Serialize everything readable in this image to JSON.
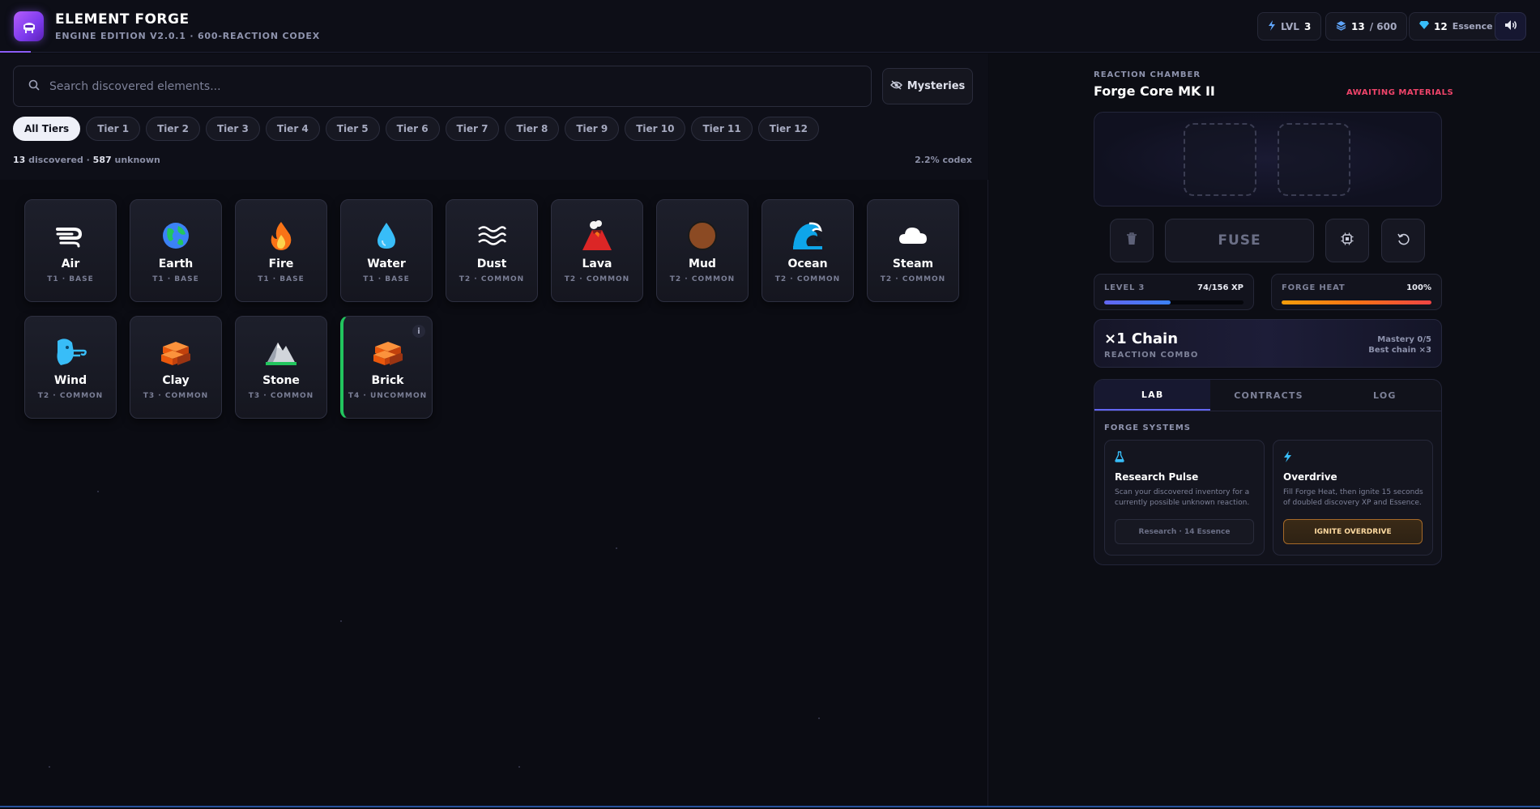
{
  "header": {
    "title": "ELEMENT FORGE",
    "subtitle": "ENGINE EDITION V2.0.1 · 600-REACTION CODEX",
    "level_label": "LVL",
    "level_value": "3",
    "discovered_value": "13",
    "discovered_total": "/ 600",
    "essence_value": "12",
    "essence_label": "Essence"
  },
  "search": {
    "placeholder": "Search discovered elements...",
    "value": ""
  },
  "mysteries_label": "Mysteries",
  "tiers": [
    "All Tiers",
    "Tier 1",
    "Tier 2",
    "Tier 3",
    "Tier 4",
    "Tier 5",
    "Tier 6",
    "Tier 7",
    "Tier 8",
    "Tier 9",
    "Tier 10",
    "Tier 11",
    "Tier 12"
  ],
  "active_tier": "All Tiers",
  "counts": {
    "discovered": "13",
    "discovered_label": "discovered ·",
    "unknown": "587",
    "unknown_label": "unknown",
    "codex_pct": "2.2% codex"
  },
  "elements": [
    {
      "name": "Air",
      "meta": "T1 · BASE",
      "icon": "wind-face-icon"
    },
    {
      "name": "Earth",
      "meta": "T1 · BASE",
      "icon": "globe-icon"
    },
    {
      "name": "Fire",
      "meta": "T1 · BASE",
      "icon": "fire-icon"
    },
    {
      "name": "Water",
      "meta": "T1 · BASE",
      "icon": "droplet-icon"
    },
    {
      "name": "Dust",
      "meta": "T2 · COMMON",
      "icon": "waves-icon"
    },
    {
      "name": "Lava",
      "meta": "T2 · COMMON",
      "icon": "volcano-icon"
    },
    {
      "name": "Mud",
      "meta": "T2 · COMMON",
      "icon": "brown-circle-icon"
    },
    {
      "name": "Ocean",
      "meta": "T2 · COMMON",
      "icon": "wave-icon"
    },
    {
      "name": "Steam",
      "meta": "T2 · COMMON",
      "icon": "cloud-icon"
    },
    {
      "name": "Wind",
      "meta": "T2 · COMMON",
      "icon": "wind-blow-icon"
    },
    {
      "name": "Clay",
      "meta": "T3 · COMMON",
      "icon": "bricks-icon"
    },
    {
      "name": "Stone",
      "meta": "T3 · COMMON",
      "icon": "mountain-icon"
    },
    {
      "name": "Brick",
      "meta": "T4 · UNCOMMON",
      "icon": "bricks-icon",
      "selected": true,
      "info": "i"
    }
  ],
  "chamber": {
    "label": "REACTION CHAMBER",
    "title": "Forge Core MK II",
    "status": "AWAITING MATERIALS",
    "fuse_label": "FUSE"
  },
  "level_meter": {
    "label": "LEVEL 3",
    "value": "74/156 XP",
    "progress": 0.474,
    "color": "#3b82f6"
  },
  "heat_meter": {
    "label": "FORGE HEAT",
    "value": "100%",
    "progress": 1.0,
    "color": "#f97316"
  },
  "combo": {
    "chain": "×1 Chain",
    "label": "REACTION COMBO",
    "mastery": "Mastery 0/5",
    "best_chain": "Best chain ×3"
  },
  "lab_tabs": [
    "LAB",
    "CONTRACTS",
    "LOG"
  ],
  "active_lab_tab": "LAB",
  "forge_systems_label": "FORGE SYSTEMS",
  "systems": [
    {
      "title": "Research Pulse",
      "desc": "Scan your discovered inventory for a currently possible unknown reaction.",
      "action": "Research · 14 Essence",
      "icon": "flask-icon"
    },
    {
      "title": "Overdrive",
      "desc": "Fill Forge Heat, then ignite 15 seconds of doubled discovery XP and Essence.",
      "action": "IGNITE OVERDRIVE",
      "icon": "bolt-icon"
    }
  ],
  "colors": {
    "accent": "#8b5cf6",
    "status_red": "#f0446a",
    "selected_green": "#22c55e",
    "overdrive_amber": "#a66a28"
  }
}
